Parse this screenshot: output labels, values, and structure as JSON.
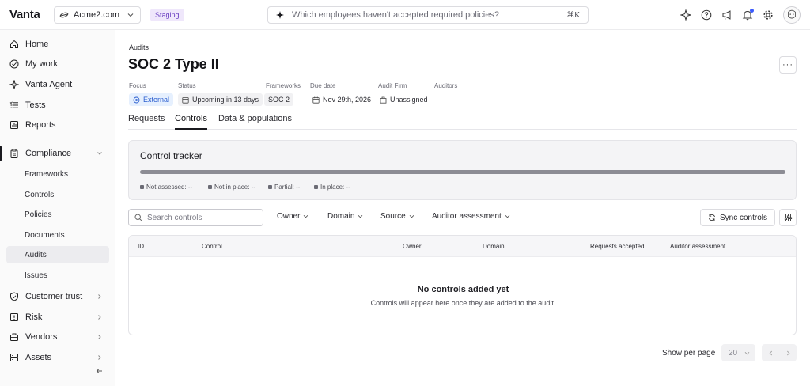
{
  "topbar": {
    "logo": "Vanta",
    "org_name": "Acme2.com",
    "env_badge": "Staging",
    "search_placeholder": "Which employees haven't accepted required policies?",
    "search_shortcut": "⌘K"
  },
  "sidebar": {
    "items": [
      {
        "label": "Home",
        "icon": "home-icon"
      },
      {
        "label": "My work",
        "icon": "check-circle-icon"
      },
      {
        "label": "Vanta Agent",
        "icon": "sparkle-icon"
      },
      {
        "label": "Tests",
        "icon": "list-check-icon"
      },
      {
        "label": "Reports",
        "icon": "report-icon"
      },
      {
        "label": "Compliance",
        "icon": "clipboard-icon"
      },
      {
        "label": "Customer trust",
        "icon": "shield-icon"
      },
      {
        "label": "Risk",
        "icon": "risk-icon"
      },
      {
        "label": "Vendors",
        "icon": "vendors-icon"
      },
      {
        "label": "Assets",
        "icon": "assets-icon"
      }
    ],
    "compliance_sub": [
      "Frameworks",
      "Controls",
      "Policies",
      "Documents",
      "Audits",
      "Issues"
    ],
    "active_sub": "Audits"
  },
  "page": {
    "breadcrumb": "Audits",
    "title": "SOC 2 Type II",
    "more": "···",
    "meta": {
      "focus_label": "Focus",
      "focus_value": "External",
      "status_label": "Status",
      "status_value": "Upcoming in 13 days",
      "frameworks_label": "Frameworks",
      "frameworks_value": "SOC 2",
      "due_label": "Due date",
      "due_value": "Nov 29th, 2026",
      "firm_label": "Audit Firm",
      "firm_value": "Unassigned",
      "auditors_label": "Auditors"
    },
    "tabs": [
      "Requests",
      "Controls",
      "Data & populations"
    ],
    "active_tab": "Controls"
  },
  "tracker": {
    "title": "Control tracker",
    "legend": [
      "Not assessed: --",
      "Not in place: --",
      "Partial: --",
      "In place: --"
    ]
  },
  "toolbar": {
    "search_placeholder": "Search controls",
    "filters": [
      "Owner",
      "Domain",
      "Source",
      "Auditor assessment"
    ],
    "sync_label": "Sync controls"
  },
  "table": {
    "columns": [
      "ID",
      "Control",
      "Owner",
      "Domain",
      "Requests accepted",
      "Auditor assessment"
    ],
    "empty_title": "No controls added yet",
    "empty_message": "Controls will appear here once they are added to the audit."
  },
  "pagination": {
    "per_page_label": "Show per page",
    "per_page_value": "20"
  }
}
